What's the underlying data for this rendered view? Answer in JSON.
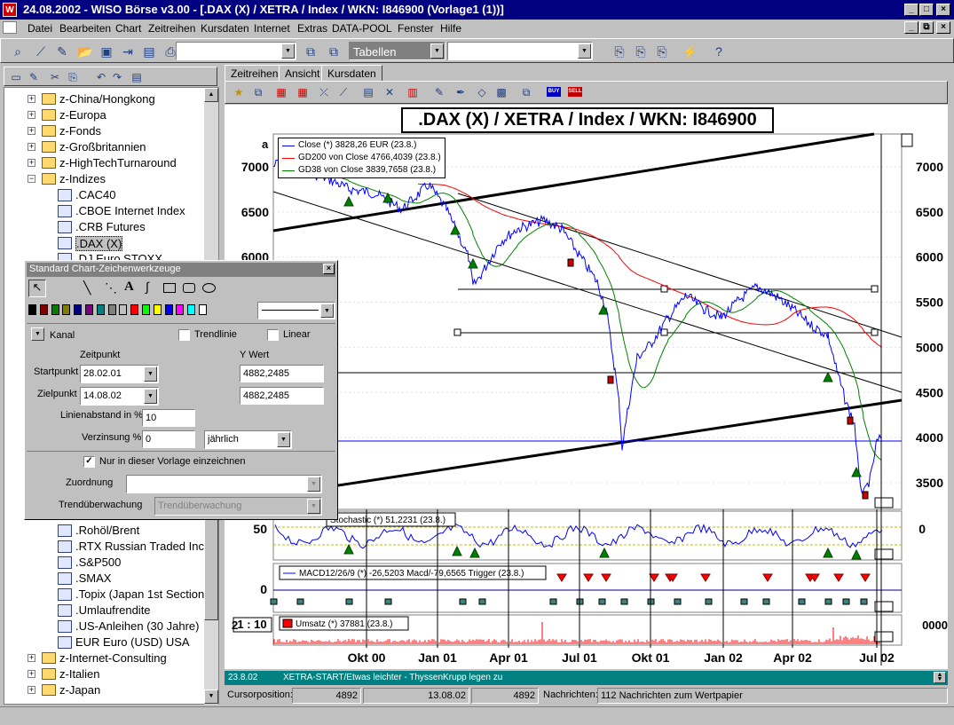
{
  "window": {
    "title": "24.08.2002 - WISO Börse  v3.00 - [.DAX (X) / XETRA / Index / WKN: I846900 (Vorlage1 (1))]"
  },
  "menu": [
    "Datei",
    "Bearbeiten",
    "Chart",
    "Zeitreihen",
    "Kursdaten",
    "Internet",
    "Extras",
    "DATA-POOL",
    "Fenster",
    "Hilfe"
  ],
  "toolbar": {
    "combo_tabellen": "Tabellen"
  },
  "tree": {
    "folders_top": [
      "z-China/Hongkong",
      "z-Europa",
      "z-Fonds",
      "z-Großbritannien",
      "z-HighTechTurnaround",
      "z-Indizes"
    ],
    "indices": [
      ".CAC40",
      ".CBOE Internet Index",
      ".CRB Futures",
      ".DAX (X)",
      ".DJ Euro STOXX"
    ],
    "indices_lower": [
      ".Rohöl/Brent",
      ".RTX Russian Traded Inc",
      ".S&P500",
      ".SMAX",
      ".Topix (Japan 1st Section",
      ".Umlaufrendite",
      ".US-Anleihen (30 Jahre)",
      "EUR Euro (USD) USA"
    ],
    "folders_bottom": [
      "z-Internet-Consulting",
      "z-Italien",
      "z-Japan"
    ]
  },
  "tabs": [
    "Zeitreihen",
    "Ansicht",
    "Kursdaten"
  ],
  "chart": {
    "title": ".DAX (X) / XETRA / Index / WKN: I846900",
    "legend": [
      {
        "label": "Close (*) 3828,26 EUR (23.8.)",
        "color": "#0000ff"
      },
      {
        "label": "GD200 von Close 4766,4039 (23.8.)",
        "color": "#ff0000"
      },
      {
        "label": "GD38 von Close 3839,7658 (23.8.)",
        "color": "#008000"
      }
    ],
    "panel_letter": "a",
    "y_ticks": [
      "7000",
      "6500",
      "6000",
      "5500",
      "5000",
      "4500",
      "4000",
      "3500"
    ],
    "x_ticks": [
      "Okt 00",
      "Jan 01",
      "Apr 01",
      "Jul 01",
      "Okt 01",
      "Jan 02",
      "Apr 02",
      "Jul 02"
    ],
    "stochastic_label": "Stochastic (*) 51,2231 (23.8.)",
    "stochastic_tick": "50",
    "macd_label": "MACD12/26/9 (*) -26,5203 Macd/-79,6565 Trigger (23.8.)",
    "macd_tick": "0",
    "umsatz_label": "Umsatz (*) 37881 (23.8.)",
    "umsatz_tick_left": "2",
    "umsatz_tick_right": "0000",
    "ratio": "1 : 10"
  },
  "dialog": {
    "title": "Standard Chart-Zeichenwerkzeuge",
    "type_label": "Kanal",
    "trendlinie": "Trendlinie",
    "linear": "Linear",
    "zeitpunkt": "Zeitpunkt",
    "ywert": "Y Wert",
    "startpunkt_label": "Startpunkt",
    "startpunkt_date": "28.02.01",
    "startpunkt_value": "4882,2485",
    "zielpunkt_label": "Zielpunkt",
    "zielpunkt_date": "14.08.02",
    "zielpunkt_value": "4882,2485",
    "linienabstand_label": "Linienabstand in %",
    "linienabstand_value": "10",
    "verzinsung_label": "Verzinsung %",
    "verzinsung_value": "0",
    "verzinsung_period": "jährlich",
    "nur_vorlage": "Nur in dieser Vorlage einzeichnen",
    "zuordnung_label": "Zuordnung",
    "trend_label": "Trendüberwachung",
    "trend_value": "Trendüberwachung",
    "colors": [
      "#000000",
      "#800000",
      "#008000",
      "#808000",
      "#000080",
      "#800080",
      "#008080",
      "#808080",
      "#c0c0c0",
      "#ff0000",
      "#00ff00",
      "#ffff00",
      "#0000ff",
      "#ff00ff",
      "#00ffff",
      "#ffffff"
    ]
  },
  "news": {
    "date": "23.8.02",
    "text": "XETRA-START/Etwas leichter - ThyssenKrupp legen zu"
  },
  "status": {
    "cursor_label": "Cursorposition:",
    "v1": "4892",
    "date": "13.08.02",
    "v2": "4892",
    "nachrichten_label": "Nachrichten:",
    "nachrichten_text": "112 Nachrichten zum Wertpapier"
  }
}
